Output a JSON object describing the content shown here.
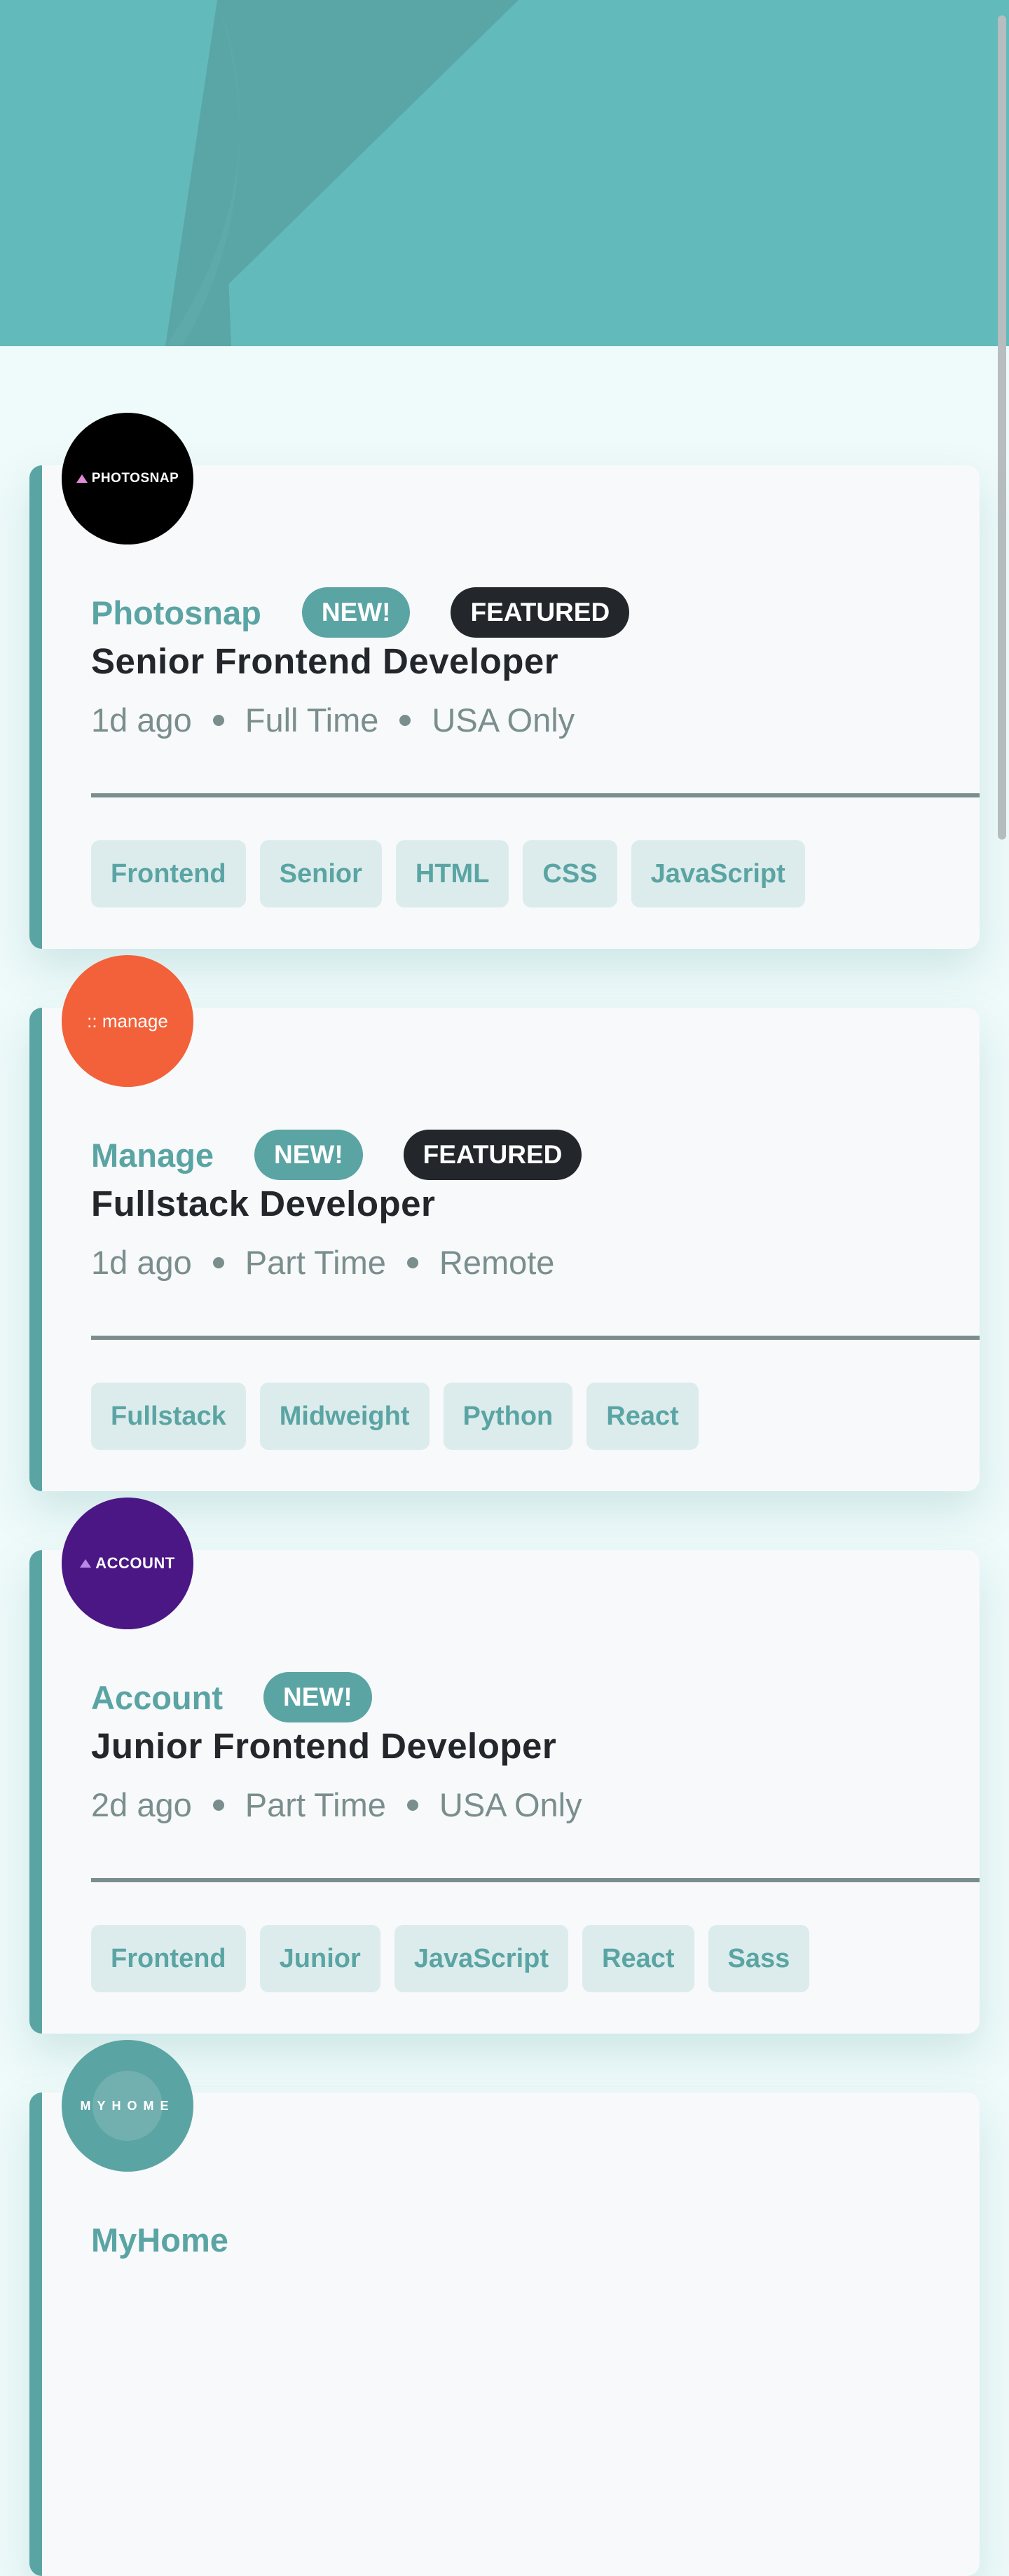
{
  "header": {
    "background_color": "#63baba"
  },
  "jobs": [
    {
      "company": "Photosnap",
      "logo": {
        "text": "PHOTOSNAP",
        "bg": "#000000",
        "mark": "triangle-icon"
      },
      "new_label": "NEW!",
      "featured_label": "FEATURED",
      "position": "Senior Frontend Developer",
      "posted": "1d ago",
      "contract": "Full Time",
      "location": "USA Only",
      "tags": [
        "Frontend",
        "Senior",
        "HTML",
        "CSS",
        "JavaScript"
      ]
    },
    {
      "company": "Manage",
      "logo": {
        "text": ":: manage",
        "bg": "#f26139"
      },
      "new_label": "NEW!",
      "featured_label": "FEATURED",
      "position": "Fullstack Developer",
      "posted": "1d ago",
      "contract": "Part Time",
      "location": "Remote",
      "tags": [
        "Fullstack",
        "Midweight",
        "Python",
        "React"
      ]
    },
    {
      "company": "Account",
      "logo": {
        "text": "ACCOUNT",
        "bg": "#4b1785",
        "mark": "triangle-icon"
      },
      "new_label": "NEW!",
      "position": "Junior Frontend Developer",
      "posted": "2d ago",
      "contract": "Part Time",
      "location": "USA Only",
      "tags": [
        "Frontend",
        "Junior",
        "JavaScript",
        "React",
        "Sass"
      ]
    },
    {
      "company": "MyHome",
      "logo": {
        "text": "MYHOME",
        "bg": "#5ba4a4"
      }
    }
  ]
}
